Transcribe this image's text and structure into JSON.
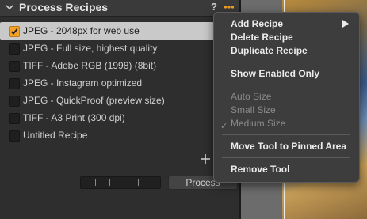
{
  "panel": {
    "title": "Process Recipes",
    "help_label": "?",
    "recipes": [
      {
        "label": "JPEG - 2048px for web use",
        "checked": true,
        "selected": true
      },
      {
        "label": "JPEG - Full size, highest quality",
        "checked": false,
        "selected": false
      },
      {
        "label": "TIFF - Adobe RGB (1998) (8bit)",
        "checked": false,
        "selected": false
      },
      {
        "label": "JPEG - Instagram optimized",
        "checked": false,
        "selected": false
      },
      {
        "label": "JPEG - QuickProof (preview size)",
        "checked": false,
        "selected": false
      },
      {
        "label": "TIFF - A3 Print (300 dpi)",
        "checked": false,
        "selected": false
      },
      {
        "label": "Untitled Recipe",
        "checked": false,
        "selected": false
      }
    ],
    "process_label": "Process"
  },
  "menu": {
    "add_recipe": "Add Recipe",
    "delete_recipe": "Delete Recipe",
    "duplicate_recipe": "Duplicate Recipe",
    "show_enabled_only": "Show Enabled Only",
    "auto_size": "Auto Size",
    "small_size": "Small Size",
    "medium_size": "Medium Size",
    "move_tool": "Move Tool to Pinned Area",
    "remove_tool": "Remove Tool"
  },
  "colors": {
    "accent": "#f3a028",
    "selected_row": "#c9c9c9",
    "panel_bg": "#2e2e2e",
    "menu_bg": "#3d3d3d"
  },
  "icons": {
    "collapse": "chevron-down-icon",
    "help": "help-icon",
    "more": "more-options-icon",
    "add": "plus-icon",
    "checkbox": "checkmark-icon",
    "submenu": "chevron-right-icon",
    "menu_check": "checkmark-icon"
  }
}
